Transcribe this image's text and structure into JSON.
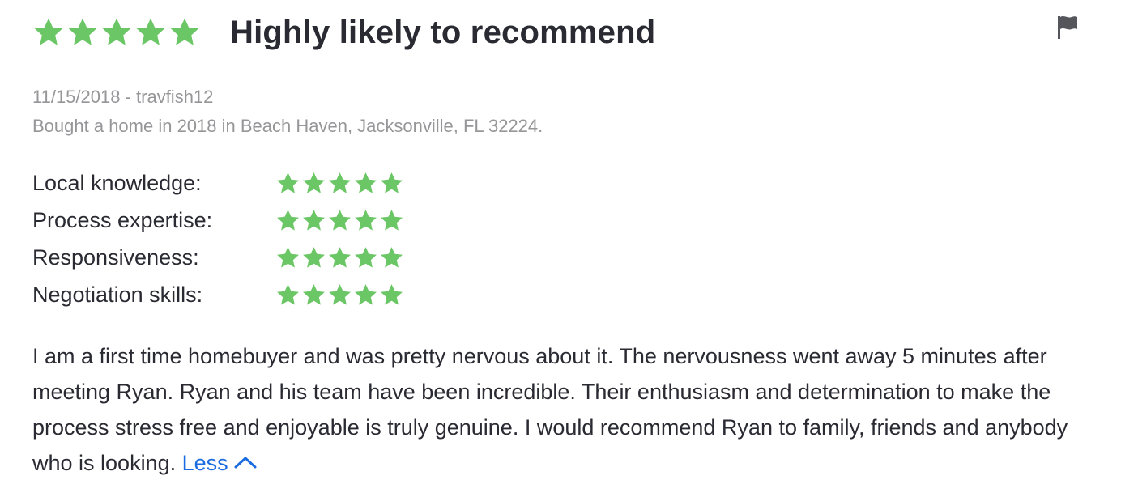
{
  "review": {
    "overall_rating": 5,
    "rating_max": 5,
    "title": "Highly likely to recommend",
    "date_author": "11/15/2018 - travfish12",
    "transaction": "Bought a home in 2018 in Beach Haven, Jacksonville, FL 32224.",
    "sub_ratings": [
      {
        "label": "Local knowledge:",
        "rating": 5
      },
      {
        "label": "Process expertise:",
        "rating": 5
      },
      {
        "label": "Responsiveness:",
        "rating": 5
      },
      {
        "label": "Negotiation skills:",
        "rating": 5
      }
    ],
    "body": "I am a first time homebuyer and was pretty nervous about it. The nervousness went away 5 minutes after meeting Ryan. Ryan and his team have been incredible. Their enthusiasm and determination to make the process stress free and enjoyable is truly genuine. I would recommend Ryan to family, friends and anybody who is looking.",
    "toggle_label": "Less",
    "toggle_icon": "chevron-up-icon",
    "report_icon": "flag-icon"
  },
  "colors": {
    "star": "#6bc665",
    "star_empty": "#d1d1d5",
    "link": "#1a6ce0",
    "meta_text": "#969699",
    "text": "#2a2a33"
  }
}
